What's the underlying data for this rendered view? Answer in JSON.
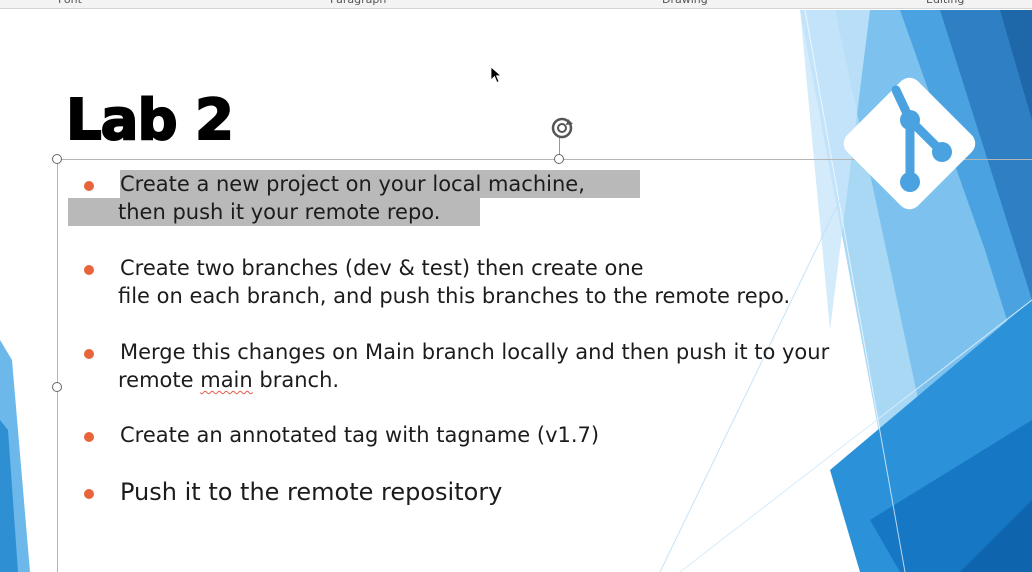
{
  "slide": {
    "title": "Lab 2",
    "items": [
      {
        "line1": "Create a new project on your local machine,",
        "line2": " then push it your remote repo."
      },
      {
        "line1": "Create two branches (dev & test) then create one",
        "line2": " file on each branch, and push this branches to the remote repo."
      },
      {
        "line1": "Merge this changes on Main branch locally and then push it to your",
        "line2_pre": " remote ",
        "line2_mark": "main",
        "line2_post": " branch."
      },
      {
        "line1": "Create an annotated tag with tagname (v1.7)"
      },
      {
        "line1": "Push it to the remote repository"
      }
    ]
  },
  "colors": {
    "bullet": "#e8643a",
    "selection_highlight": "#b9b9b9",
    "git_logo": "#ffffff",
    "theme_blue_dark": "#1f6fb0",
    "theme_blue_mid": "#2e94d8",
    "theme_blue_light": "#7fc3ee"
  },
  "icons": {
    "logo": "git-logo-icon",
    "rotate": "rotate-handle-icon",
    "cursor": "mouse-pointer-icon"
  }
}
